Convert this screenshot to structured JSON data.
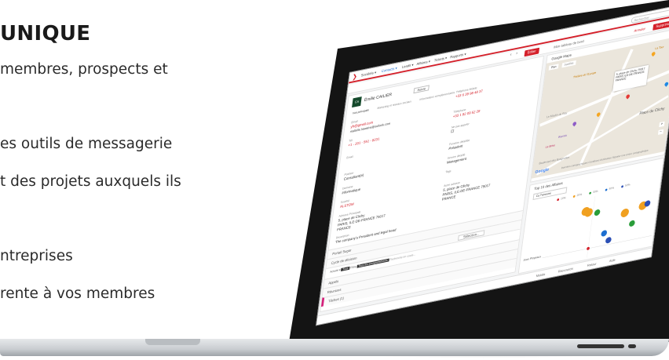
{
  "marketing": {
    "title": "UNIQUE",
    "bullets": [
      "membres, prospects et",
      "es outils de messagerie",
      "t des projets auxquels ils",
      "ntreprises",
      "rente à vos membres"
    ]
  },
  "app": {
    "menu": [
      "Sociétés ▾",
      "Contacts ▾",
      "Leads ▾",
      "Affaires ▾",
      "Tickets ▾",
      "Rapports ▾"
    ],
    "search_placeholder": "Rechercher",
    "toolbar": {
      "nav_prev": "‹",
      "nav_next": "›",
      "edit_label": "Éditer",
      "dashboard_label": "Mon tableau de bord",
      "cancel_label": "Annuler",
      "delete_label": "Supprimer"
    },
    "contact": {
      "avatar": "CA",
      "name": "Émilie CAILIER",
      "follow": "Suivre",
      "tabs": [
        "Vue principale",
        "Marketing et réseaux sociaux",
        "Informations complémentaires"
      ],
      "fields": [
        {
          "label": "Email",
          "value": "yfr@gmail.com"
        },
        {
          "label": "",
          "value": "mattelle.hawkins@outlook.com"
        },
        {
          "label": "Tél",
          "value": "+1 - 201 - 551 - 8231"
        },
        {
          "label": "Email",
          "value": ""
        },
        {
          "label": "Position",
          "value": "Consultant(e)"
        },
        {
          "label": "Domaine",
          "value": "Informatique"
        },
        {
          "label": "Société",
          "value": "ALSTOM"
        },
        {
          "label": "Adresse Principale",
          "value": "5, place de Clichy"
        },
        {
          "label": "",
          "value": "PARIS, ILE-DE-FRANCE 75017"
        },
        {
          "label": "",
          "value": "FRANCE"
        },
        {
          "label": "Description",
          "value": "The company's President and legal head"
        }
      ],
      "fields_right": [
        {
          "label": "Téléphone Mobile",
          "value": "+33 6 39 98 48 37"
        },
        {
          "label": "Téléphone",
          "value": "+33 1 82 09 52 28"
        },
        {
          "label": "Ne pas appeler",
          "value": ""
        },
        {
          "label": "Fonction détaillée",
          "value": "Président"
        },
        {
          "label": "Service détaillé",
          "value": "Management"
        },
        {
          "label": "Tags",
          "value": ""
        },
        {
          "label": "Autre adresse",
          "value": "5, place de Clichy"
        },
        {
          "label": "",
          "value": "PARIS, ILE-DE-FRANCE 75017"
        },
        {
          "label": "",
          "value": "FRANCE"
        }
      ]
    },
    "sections": [
      "Portail Sugar",
      "Cycle de décision",
      "Appels",
      "Réunions",
      "Tâches (1)"
    ],
    "activity_filters": [
      "Activité ▾",
      "Tous",
      "Filtre",
      "Tous les enregistrements",
      "Recherche en cours..."
    ],
    "select_label": "Sélection...",
    "map": {
      "title": "Google Maps",
      "tabs": [
        "Plan",
        "Satellite"
      ],
      "labels": [
        "Théâtre de l'Europe",
        "La Tour",
        "Boulevard des Batignolles",
        "Le Moulin du Roy",
        "Place de Clichy",
        "Warmix",
        "La Brise",
        "Google"
      ],
      "popup": "5, place de Clichy 75017 PARIS ILE-DE-FRANCE FRANCE",
      "footer": "Données cartographiques  Conditions d'utilisation  Signaler une erreur cartographique"
    },
    "chart": {
      "title": "Top 10 des Affaires",
      "select": "Ca Trimestre",
      "legend": [
        "10%",
        "20%",
        "30%",
        "40%",
        "50%"
      ],
      "ylabel": "Jean Phrpeaux"
    },
    "footer": [
      "Mobile",
      "Raccourcis",
      "Retour",
      "Aide"
    ]
  },
  "chart_data": {
    "type": "scatter",
    "title": "Top 10 des Affaires",
    "legend": [
      "10%",
      "20%",
      "30%",
      "40%",
      "50%"
    ],
    "series": [
      {
        "name": "10%",
        "points": [
          [
            0.42,
            0.15
          ]
        ]
      },
      {
        "name": "20%",
        "points": [
          [
            0.35,
            0.78
          ],
          [
            0.38,
            0.75
          ],
          [
            0.72,
            0.62
          ],
          [
            0.88,
            0.68
          ]
        ]
      },
      {
        "name": "30%",
        "points": [
          [
            0.8,
            0.42
          ],
          [
            0.46,
            0.72
          ]
        ]
      },
      {
        "name": "40%",
        "points": [
          [
            0.55,
            0.35
          ]
        ]
      },
      {
        "name": "50%",
        "points": [
          [
            0.6,
            0.22
          ],
          [
            0.92,
            0.7
          ]
        ]
      }
    ],
    "colors": [
      "#d4202a",
      "#f0a020",
      "#2a9d3a",
      "#1e6fd0",
      "#2b4fb5"
    ]
  }
}
